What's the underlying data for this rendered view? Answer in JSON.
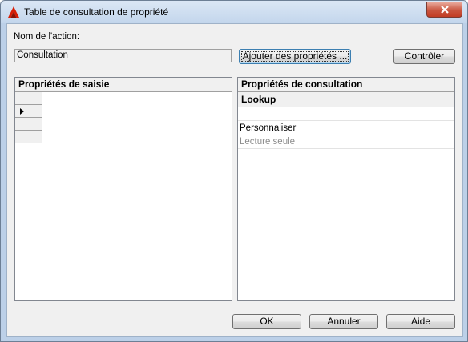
{
  "window": {
    "title": "Table de consultation de propriété",
    "app_icon": "autocad-logo-icon",
    "close_icon": "close-icon"
  },
  "form": {
    "action_name_label": "Nom de l'action:",
    "action_name_value": "Consultation",
    "add_properties_button": "Ajouter des propriétés ...",
    "check_button": "Contrôler"
  },
  "input_properties": {
    "header": "Propriétés de saisie",
    "rows": [
      "",
      "",
      "",
      ""
    ],
    "current_row_marker": "arrow-right-icon"
  },
  "lookup_properties": {
    "header": "Propriétés de consultation",
    "column": "Lookup",
    "items": [
      "",
      "Personnaliser",
      "Lecture seule"
    ]
  },
  "footer": {
    "ok": "OK",
    "cancel": "Annuler",
    "help": "Aide"
  },
  "colors": {
    "accent_close": "#c23c24",
    "default_button_border": "#3c7fb1"
  }
}
